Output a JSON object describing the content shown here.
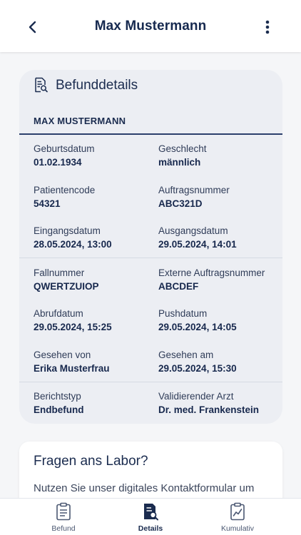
{
  "header": {
    "title": "Max Mustermann",
    "back_icon": "chevron-left-icon",
    "menu_icon": "more-vertical-icon"
  },
  "details_card": {
    "icon": "document-search-icon",
    "title": "Befunddetails",
    "patient_name": "MAX MUSTERMANN",
    "fields": {
      "birth_date": {
        "label": "Geburtsdatum",
        "value": "01.02.1934"
      },
      "gender": {
        "label": "Geschlecht",
        "value": "männlich"
      },
      "patient_code": {
        "label": "Patientencode",
        "value": "54321"
      },
      "order_number": {
        "label": "Auftragsnummer",
        "value": "ABC321D"
      },
      "received_date": {
        "label": "Eingangsdatum",
        "value": "28.05.2024, 13:00"
      },
      "output_date": {
        "label": "Ausgangsdatum",
        "value": "29.05.2024, 14:01"
      },
      "case_number": {
        "label": "Fallnummer",
        "value": "QWERTZUIOP"
      },
      "external_order": {
        "label": "Externe Auftragsnummer",
        "value": "ABCDEF"
      },
      "retrieval_date": {
        "label": "Abrufdatum",
        "value": "29.05.2024, 15:25"
      },
      "push_date": {
        "label": "Pushdatum",
        "value": "29.05.2024, 14:05"
      },
      "seen_by": {
        "label": "Gesehen von",
        "value": "Erika Musterfrau"
      },
      "seen_at": {
        "label": "Gesehen am",
        "value": "29.05.2024, 15:30"
      },
      "report_type": {
        "label": "Berichtstyp",
        "value": "Endbefund"
      },
      "validating_doctor": {
        "label": "Validierender Arzt",
        "value": "Dr. med. Frankenstein"
      }
    }
  },
  "lab_card": {
    "title": "Fragen ans Labor?",
    "text": "Nutzen Sie unser digitales Kontaktformular um"
  },
  "bottom_nav": {
    "items": [
      {
        "label": "Befund",
        "icon": "clipboard-icon"
      },
      {
        "label": "Details",
        "icon": "document-search-icon",
        "active": true
      },
      {
        "label": "Kumulativ",
        "icon": "clipboard-chart-icon"
      }
    ]
  },
  "colors": {
    "primary": "#1b2c4f",
    "card_bg": "#eceef3",
    "page_bg": "#f5f6f8"
  }
}
